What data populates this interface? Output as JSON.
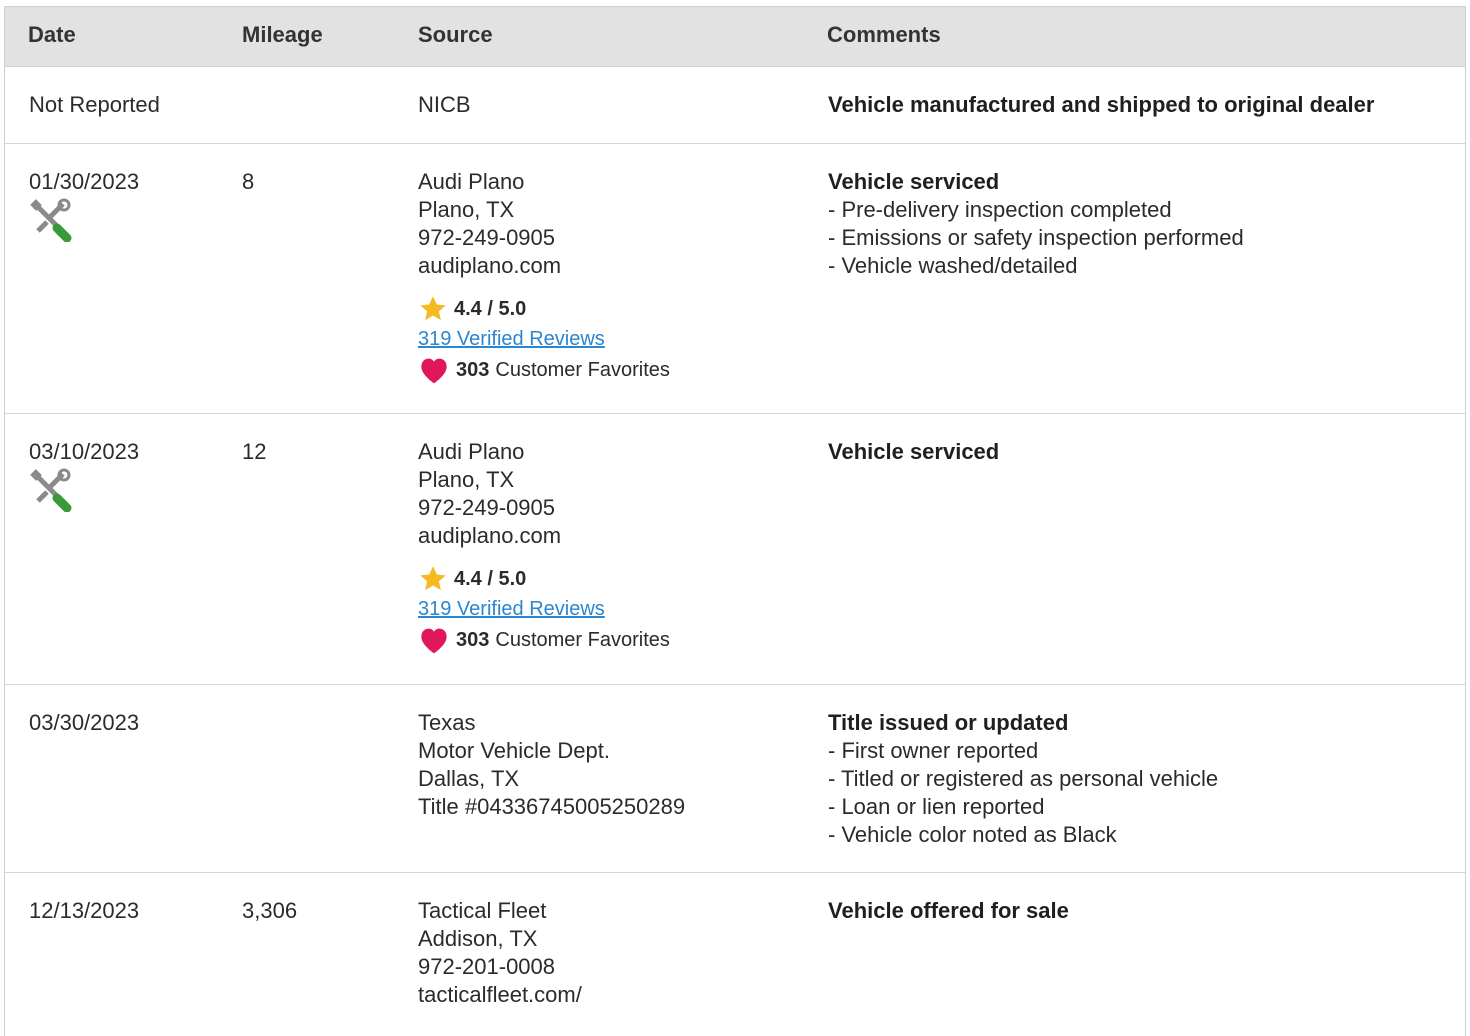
{
  "columns": {
    "date": "Date",
    "mileage": "Mileage",
    "source": "Source",
    "comments": "Comments"
  },
  "rows": [
    {
      "date": "Not Reported",
      "mileage": "",
      "source": [
        "NICB"
      ],
      "comment_title": "Vehicle manufactured and shipped to original dealer",
      "comment_items": []
    },
    {
      "date": "01/30/2023",
      "mileage": "8",
      "source": [
        "Audi Plano",
        "Plano, TX",
        "972-249-0905",
        "audiplano.com"
      ],
      "rating": "4.4 / 5.0",
      "reviews": "319 Verified Reviews",
      "favorites_count": "303",
      "favorites_label": "Customer Favorites",
      "comment_title": "Vehicle serviced",
      "comment_items": [
        "- Pre-delivery inspection completed",
        "- Emissions or safety inspection performed",
        "- Vehicle washed/detailed"
      ]
    },
    {
      "date": "03/10/2023",
      "mileage": "12",
      "source": [
        "Audi Plano",
        "Plano, TX",
        "972-249-0905",
        "audiplano.com"
      ],
      "rating": "4.4 / 5.0",
      "reviews": "319 Verified Reviews",
      "favorites_count": "303",
      "favorites_label": "Customer Favorites",
      "comment_title": "Vehicle serviced",
      "comment_items": []
    },
    {
      "date": "03/30/2023",
      "mileage": "",
      "source": [
        "Texas",
        "Motor Vehicle Dept.",
        "Dallas, TX",
        "Title #04336745005250289"
      ],
      "comment_title": "Title issued or updated",
      "comment_items": [
        "- First owner reported",
        "- Titled or registered as personal vehicle",
        "- Loan or lien reported",
        "- Vehicle color noted as Black"
      ]
    },
    {
      "date": "12/13/2023",
      "mileage": "3,306",
      "source": [
        "Tactical Fleet",
        "Addison, TX",
        "972-201-0008",
        "tacticalfleet.com/"
      ],
      "comment_title": "Vehicle offered for sale",
      "comment_items": []
    }
  ],
  "icons": {
    "service": "service-tools-icon",
    "rating": "star-icon",
    "favorites": "heart-icon"
  },
  "colors": {
    "header_bg": "#e2e2e2",
    "link": "#2a86d1",
    "star": "#f5b921",
    "heart": "#e0185a",
    "wrench_green": "#3a9a3a"
  }
}
